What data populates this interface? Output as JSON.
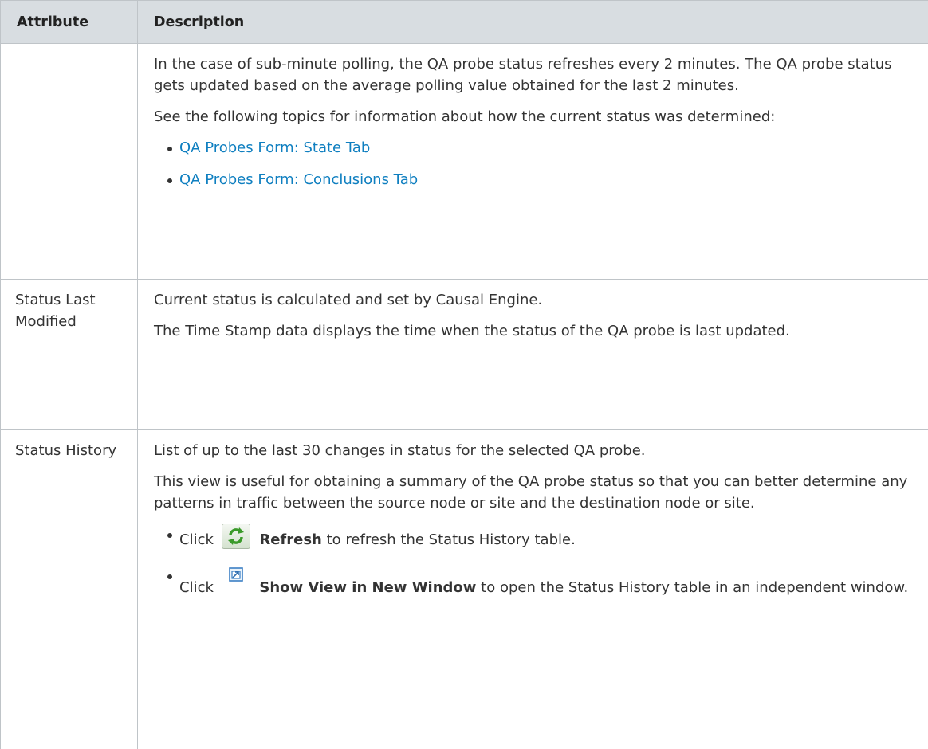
{
  "header": {
    "attribute_label": "Attribute",
    "description_label": "Description"
  },
  "rows": {
    "cont": {
      "p1": "In the case of sub-minute polling, the QA probe status refreshes every 2 minutes. The QA probe status gets updated based on the average polling value obtained for the last 2 minutes.",
      "p2": "See the following topics for information about how the current status was determined:",
      "link1": "QA Probes Form: State Tab",
      "link2": "QA Probes Form: Conclusions Tab"
    },
    "status_last_modified": {
      "attribute": "Status Last Modified",
      "p1": "Current status is calculated and set by Causal Engine.",
      "p2": "The Time Stamp data displays the time when the status of the QA probe is last updated."
    },
    "status_history": {
      "attribute": "Status History",
      "p1": "List of up to the last 30 changes in status for the selected QA probe.",
      "p2": "This view is useful for obtaining a summary of the QA probe status so that you can better determine any patterns in traffic between the source node or site and the destination node or site.",
      "b1_prefix": "Click",
      "b1_icon": "refresh-icon",
      "b1_label": "Refresh",
      "b1_suffix": "to refresh the Status History table.",
      "b2_prefix": "Click",
      "b2_icon": "show-view-in-new-window-icon",
      "b2_label": "Show View in New Window",
      "b2_suffix": "to open the Status History table in an independent window."
    }
  },
  "colors": {
    "header_bg": "#d8dde1",
    "link": "#0f7fc0",
    "text": "#333333",
    "border": "#bfc4c8"
  }
}
